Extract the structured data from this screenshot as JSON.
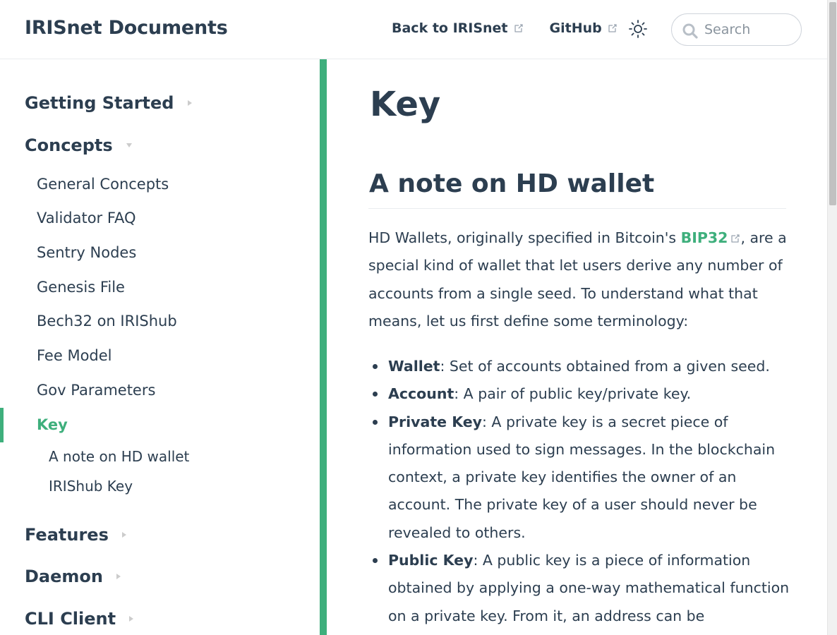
{
  "navbar": {
    "site_name": "IRISnet Documents",
    "links": [
      {
        "label": "Back to IRISnet",
        "icon": "external-link-icon"
      },
      {
        "label": "GitHub",
        "icon": "external-link-icon"
      }
    ],
    "theme_toggle_icon": "sun-icon",
    "search": {
      "placeholder": "Search",
      "value": ""
    }
  },
  "sidebar": {
    "groups": [
      {
        "label": "Getting Started",
        "expanded": false
      },
      {
        "label": "Concepts",
        "expanded": true
      },
      {
        "label": "Features",
        "expanded": false
      },
      {
        "label": "Daemon",
        "expanded": false
      },
      {
        "label": "CLI Client",
        "expanded": false
      }
    ],
    "concepts_items": [
      "General Concepts",
      "Validator FAQ",
      "Sentry Nodes",
      "Genesis File",
      "Bech32 on IRIShub",
      "Fee Model",
      "Gov Parameters",
      "Key"
    ],
    "active_item": "Key",
    "key_subitems": [
      "A note on HD wallet",
      "IRIShub Key"
    ]
  },
  "main": {
    "title": "Key",
    "section_heading": "A note on HD wallet",
    "intro": {
      "before_link": "HD Wallets, originally specified in Bitcoin's ",
      "link_text": "BIP32",
      "after_link": ", are a special kind of wallet that let users derive any number of accounts from a single seed. To understand what that means, let us first define some terminology:"
    },
    "terms": [
      {
        "term": "Wallet",
        "definition": ": Set of accounts obtained from a given seed."
      },
      {
        "term": "Account",
        "definition": ": A pair of public key/private key."
      },
      {
        "term": "Private Key",
        "definition": ": A private key is a secret piece of information used to sign messages. In the blockchain context, a private key identifies the owner of an account. The private key of a user should never be revealed to others."
      },
      {
        "term": "Public Key",
        "definition": ": A public key is a piece of information obtained by applying a one-way mathematical function on a private key. From it, an address can be"
      }
    ]
  },
  "colors": {
    "accent": "#3eaf7c",
    "text": "#2c3e50",
    "border": "#eaecef"
  }
}
